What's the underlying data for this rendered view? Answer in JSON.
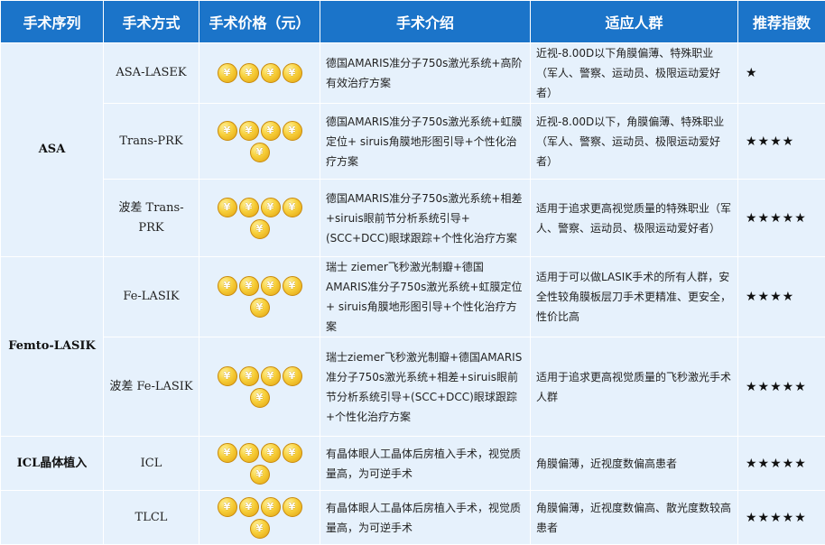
{
  "table": {
    "headers": [
      "手术序列",
      "手术方式",
      "手术价格（元）",
      "手术介绍",
      "适应人群",
      "推荐指数"
    ],
    "coin_symbol": "¥",
    "star_symbol": "★",
    "groups": {
      "asa": "ASA",
      "femto": "Femto-LASIK",
      "icl": "ICL晶体植入"
    },
    "rows": [
      {
        "method": "ASA-LASEK",
        "coins": 4,
        "intro": "德国AMARIS准分子750s激光系统+高阶有效治疗方案",
        "crowd": "近视-8.00D以下角膜偏薄、特殊职业（军人、警察、运动员、极限运动爱好者）",
        "stars": "★"
      },
      {
        "method": "Trans-PRK",
        "coins": 5,
        "intro": "德国AMARIS准分子750s激光系统+虹膜定位+ siruis角膜地形图引导+个性化治疗方案",
        "crowd": "近视-8.00D以下，角膜偏薄、特殊职业（军人、警察、运动员、极限运动爱好者）",
        "stars": "★★★★"
      },
      {
        "method": "波差 Trans-PRK",
        "coins": 5,
        "intro": "德国AMARIS准分子750s激光系统+相差+siruis眼前节分析系统引导+(SCC+DCC)眼球跟踪+个性化治疗方案",
        "crowd": "适用于追求更高视觉质量的特殊职业（军人、警察、运动员、极限运动爱好者）",
        "stars": "★★★★★"
      },
      {
        "method": "Fe-LASIK",
        "coins": 5,
        "intro": "瑞士 ziemer飞秒激光制瓣+德国AMARIS准分子750s激光系统+虹膜定位+ siruis角膜地形图引导+个性化治疗方案",
        "crowd": "适用于可以做LASIK手术的所有人群，安全性较角膜板层刀手术更精准、更安全，性价比高",
        "stars": "★★★★"
      },
      {
        "method": "波差 Fe-LASIK",
        "coins": 5,
        "intro": "瑞士ziemer飞秒激光制瓣+德国AMARIS准分子750s激光系统+相差+siruis眼前节分析系统引导+(SCC+DCC)眼球跟踪+个性化治疗方案",
        "crowd": "适用于追求更高视觉质量的飞秒激光手术人群",
        "stars": "★★★★★"
      },
      {
        "method": "ICL",
        "coins": 5,
        "intro": "有晶体眼人工晶体后房植入手术，视觉质量高，为可逆手术",
        "crowd": "角膜偏薄，近视度数偏高患者",
        "stars": "★★★★★"
      },
      {
        "method": "TLCL",
        "coins": 5,
        "intro": "有晶体眼人工晶体后房植入手术，视觉质量高，为可逆手术",
        "crowd": "角膜偏薄，近视度数偏高、散光度数较高患者",
        "stars": "★★★★★"
      }
    ]
  }
}
